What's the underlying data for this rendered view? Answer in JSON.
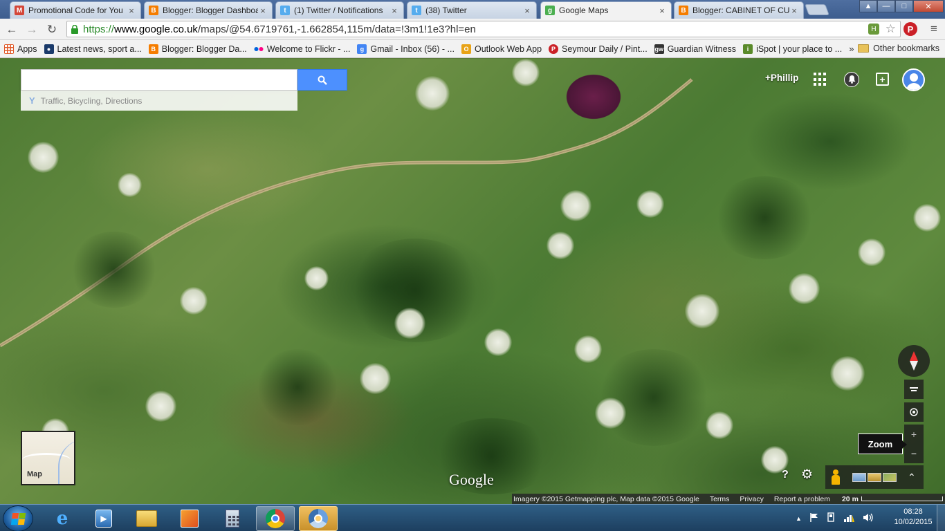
{
  "browser": {
    "tabs": [
      {
        "label": "Promotional Code for You",
        "favicon": "gmail-icon",
        "color": "#d44638",
        "letter": "M"
      },
      {
        "label": "Blogger: Blogger Dashboa",
        "favicon": "blogger-icon",
        "color": "#f57d00",
        "letter": "B"
      },
      {
        "label": "(1) Twitter / Notifications",
        "favicon": "twitter-icon",
        "color": "#55acee",
        "letter": "t"
      },
      {
        "label": "(38) Twitter",
        "favicon": "twitter-icon",
        "color": "#55acee",
        "letter": "t"
      },
      {
        "label": "Google Maps",
        "favicon": "google-maps-icon",
        "color": "#4caf50",
        "letter": "g",
        "active": true
      },
      {
        "label": "Blogger: CABINET OF CUR",
        "favicon": "blogger-icon",
        "color": "#f57d00",
        "letter": "B"
      }
    ],
    "close_glyph": "×",
    "window_buttons": {
      "minimize": "—",
      "maximize": "□",
      "close": "✕",
      "profile": "▲"
    },
    "nav": {
      "back": "←",
      "forward": "→",
      "reload": "↻"
    },
    "url": {
      "proto": "https://",
      "host": "www.google.co.uk",
      "path": "/maps/@54.6719761,-1.662854,115m/data=!3m1!1e3?hl=en"
    },
    "ext_badge": "H",
    "star": "☆",
    "pinterest": "P",
    "menu_glyph": "≡"
  },
  "bookmarks": {
    "items": [
      {
        "label": "Apps",
        "icon": "apps-icon",
        "color": "#e05a2a",
        "letter": "⋮"
      },
      {
        "label": "Latest news, sport a...",
        "icon": "news-icon",
        "color": "#1a3a6a",
        "letter": "●"
      },
      {
        "label": "Blogger: Blogger Da...",
        "icon": "blogger-icon",
        "color": "#f57d00",
        "letter": "B"
      },
      {
        "label": "Welcome to Flickr - ...",
        "icon": "flickr-icon",
        "color": "#0063dc",
        "letter": "••"
      },
      {
        "label": "Gmail - Inbox (56) - ...",
        "icon": "google-icon",
        "color": "#4285f4",
        "letter": "g"
      },
      {
        "label": "Outlook Web App",
        "icon": "outlook-icon",
        "color": "#e8a317",
        "letter": "O"
      },
      {
        "label": "Seymour Daily / Pint...",
        "icon": "pinterest-icon",
        "color": "#cb2027",
        "letter": "P"
      },
      {
        "label": "Guardian Witness",
        "icon": "guardian-icon",
        "color": "#333333",
        "letter": "gw"
      },
      {
        "label": "iSpot | your place to ...",
        "icon": "ispot-icon",
        "color": "#5a8a2a",
        "letter": "i"
      }
    ],
    "more": "»",
    "other": "Other bookmarks"
  },
  "map": {
    "search": {
      "value": "",
      "placeholder": ""
    },
    "suggestion": "Traffic, Bicycling, Directions",
    "user": "+Phillip",
    "share_glyph": "+",
    "notif_glyph": "🔔",
    "zoom_tooltip": "Zoom",
    "zoom_in": "+",
    "zoom_out": "−",
    "minimap_label": "Map",
    "logo": "Google",
    "help": "?",
    "gear": "⚙",
    "expand": "⌃",
    "attribution": {
      "imagery": "Imagery ©2015 Getmapping plc, Map data ©2015 Google",
      "terms": "Terms",
      "privacy": "Privacy",
      "report": "Report a problem",
      "scale": "20 m"
    }
  },
  "taskbar": {
    "time": "08:28",
    "date": "10/02/2015",
    "tray_up": "▲"
  }
}
